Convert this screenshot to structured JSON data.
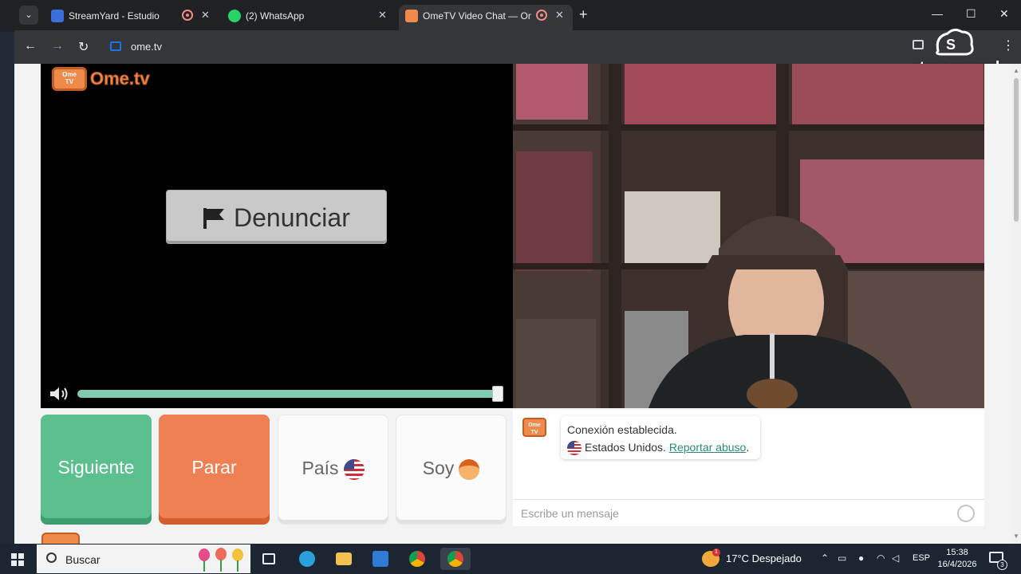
{
  "browser": {
    "tabs": [
      {
        "title": "StreamYard - Estudio",
        "active": false,
        "recording": true
      },
      {
        "title": "(2) WhatsApp",
        "active": false,
        "recording": false
      },
      {
        "title": "OmeTV Video Chat — Ome",
        "active": true,
        "recording": true
      }
    ],
    "url": "ome.tv"
  },
  "watermark": {
    "text": "streamyard"
  },
  "ometv": {
    "logo_badge": "Ome\nTV",
    "logo_word": "Ome.tv",
    "report_button": "Denunciar",
    "volume_level": 1.0,
    "buttons": {
      "next": "Siguiente",
      "stop": "Parar",
      "country": "País",
      "iam": "Soy"
    },
    "chat": {
      "status": "Conexión establecida.",
      "country": "Estados Unidos.",
      "report_abuse": "Reportar abuso",
      "period": ".",
      "input_placeholder": "Escribe un mensaje"
    }
  },
  "taskbar": {
    "search_label": "Buscar",
    "weather_temp": "17°C",
    "weather_desc": "Despejado",
    "weather_badge": "1",
    "language": "ESP",
    "time": "15:38",
    "date": "16/4/2026",
    "notification_count": "3"
  },
  "colors": {
    "next": "#5bbf8e",
    "stop": "#ee8054",
    "brand_orange": "#f08a4b",
    "link_green": "#2a8a74"
  }
}
